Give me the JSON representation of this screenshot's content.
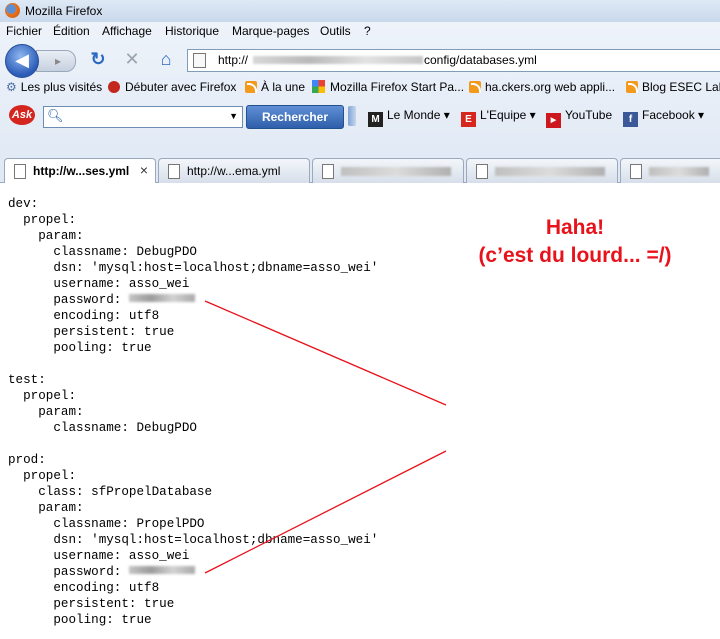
{
  "window": {
    "title": "Mozilla Firefox"
  },
  "menu": [
    "Fichier",
    "Édition",
    "Affichage",
    "Historique",
    "Marque-pages",
    "Outils",
    "?"
  ],
  "address": {
    "prefix": "http://",
    "suffix": "config/databases.yml"
  },
  "bookmarks": [
    {
      "label": "Les plus visités",
      "icon": "gear-icon"
    },
    {
      "label": "Débuter avec Firefox",
      "icon": "firefox-red-icon"
    },
    {
      "label": "À la une",
      "icon": "rss-icon"
    },
    {
      "label": "Mozilla Firefox Start Pa...",
      "icon": "google-icon"
    },
    {
      "label": "ha.ckers.org web appli...",
      "icon": "rss-icon"
    },
    {
      "label": "Blog ESEC Lab",
      "icon": "rss-icon"
    }
  ],
  "search": {
    "button_label": "Rechercher",
    "value": ""
  },
  "toolbar_links": [
    {
      "label": "Le Monde",
      "icon": "lemonde-icon"
    },
    {
      "label": "L'Equipe",
      "icon": "lequipe-icon"
    },
    {
      "label": "YouTube",
      "icon": "youtube-icon"
    },
    {
      "label": "Facebook",
      "icon": "facebook-icon"
    }
  ],
  "tabs": [
    {
      "label": "http://w...ses.yml",
      "active": true
    },
    {
      "label": "http://w...ema.yml",
      "active": false
    }
  ],
  "yaml_lines": [
    "dev:",
    "  propel:",
    "    param:",
    "      classname: DebugPDO",
    "      dsn: 'mysql:host=localhost;dbname=asso_wei'",
    "      username: asso_wei",
    "      password: ",
    "      encoding: utf8",
    "      persistent: true",
    "      pooling: true",
    "",
    "test:",
    "  propel:",
    "    param:",
    "      classname: DebugPDO",
    "",
    "prod:",
    "  propel:",
    "    class: sfPropelDatabase",
    "    param:",
    "      classname: PropelPDO",
    "      dsn: 'mysql:host=localhost;dbname=asso_wei'",
    "      username: asso_wei",
    "      password: ",
    "      encoding: utf8",
    "      persistent: true",
    "      pooling: true"
  ],
  "annotation": {
    "line1": "Haha!",
    "line2": "(c’est du lourd... =/)",
    "color": "#e8121b"
  }
}
